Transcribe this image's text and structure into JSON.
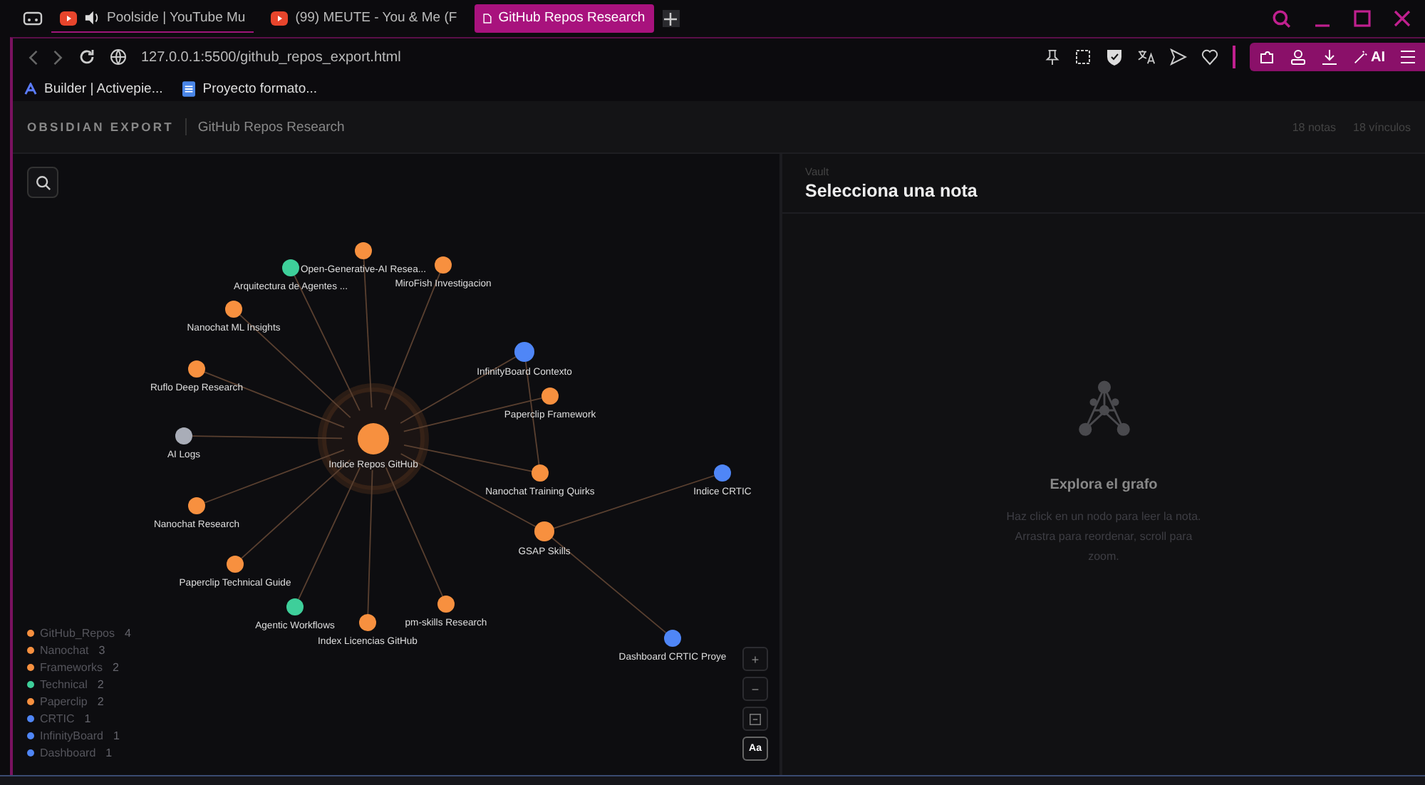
{
  "browser": {
    "tabs": [
      {
        "title": "Poolside | YouTube Mu",
        "selected": false,
        "audio": true
      },
      {
        "title": "(99) MEUTE - You & Me (F",
        "selected": false,
        "audio": false
      },
      {
        "title": "GitHub Repos Research",
        "selected": true,
        "audio": false
      }
    ],
    "address": "127.0.0.1:5500/github_repos_export.html",
    "ai_label": "AI",
    "bookmarks": [
      "Builder | Activepie...",
      "Proyecto formato..."
    ]
  },
  "header": {
    "brand": "OBSIDIAN EXPORT",
    "title": "GitHub Repos Research",
    "notes": "18 notas",
    "links": "18 vínculos"
  },
  "graph": {
    "nodes": [
      {
        "label": "Open-Generative-AI Resea...",
        "color": "#f7903f"
      },
      {
        "label": "Arquitectura de Agentes ...",
        "color": "#3ecf9a"
      },
      {
        "label": "MiroFish Investigacion",
        "color": "#f7903f"
      },
      {
        "label": "Nanochat ML Insights",
        "color": "#f7903f"
      },
      {
        "label": "InfinityBoard Contexto",
        "color": "#4f86f7"
      },
      {
        "label": "Ruflo Deep Research",
        "color": "#f7903f"
      },
      {
        "label": "Paperclip Framework",
        "color": "#f7903f"
      },
      {
        "label": "AI Logs",
        "color": "#a9adb8"
      },
      {
        "label": "Indice Repos GitHub",
        "color": "#f7903f"
      },
      {
        "label": "Nanochat Training Quirks",
        "color": "#f7903f"
      },
      {
        "label": "Indice CRTIC",
        "color": "#4f86f7"
      },
      {
        "label": "Nanochat Research",
        "color": "#f7903f"
      },
      {
        "label": "GSAP Skills",
        "color": "#f7903f"
      },
      {
        "label": "Paperclip Technical Guide",
        "color": "#f7903f"
      },
      {
        "label": "Agentic Workflows",
        "color": "#3ecf9a"
      },
      {
        "label": "pm-skills Research",
        "color": "#f7903f"
      },
      {
        "label": "Index Licencias GitHub",
        "color": "#f7903f"
      },
      {
        "label": "Dashboard CRTIC Proye",
        "color": "#4f86f7"
      }
    ],
    "legend": [
      {
        "name": "GitHub_Repos",
        "count": "4",
        "color": "#f7903f"
      },
      {
        "name": "Nanochat",
        "count": "3",
        "color": "#f7903f"
      },
      {
        "name": "Frameworks",
        "count": "2",
        "color": "#f7903f"
      },
      {
        "name": "Technical",
        "count": "2",
        "color": "#3ecf9a"
      },
      {
        "name": "Paperclip",
        "count": "2",
        "color": "#f7903f"
      },
      {
        "name": "CRTIC",
        "count": "1",
        "color": "#4f86f7"
      },
      {
        "name": "InfinityBoard",
        "count": "1",
        "color": "#4f86f7"
      },
      {
        "name": "Dashboard",
        "count": "1",
        "color": "#4f86f7"
      }
    ],
    "controls": [
      {
        "kind": "zoom-in",
        "label": "+"
      },
      {
        "kind": "zoom-out",
        "label": "−"
      },
      {
        "kind": "fit"
      },
      {
        "kind": "labels",
        "label": "Aa"
      }
    ]
  },
  "note": {
    "eyebrow": "Vault",
    "title": "Selecciona una nota",
    "empty_title": "Explora el grafo",
    "empty_text": "Haz click en un nodo para leer la nota. Arrastra para reordenar, scroll para zoom."
  }
}
